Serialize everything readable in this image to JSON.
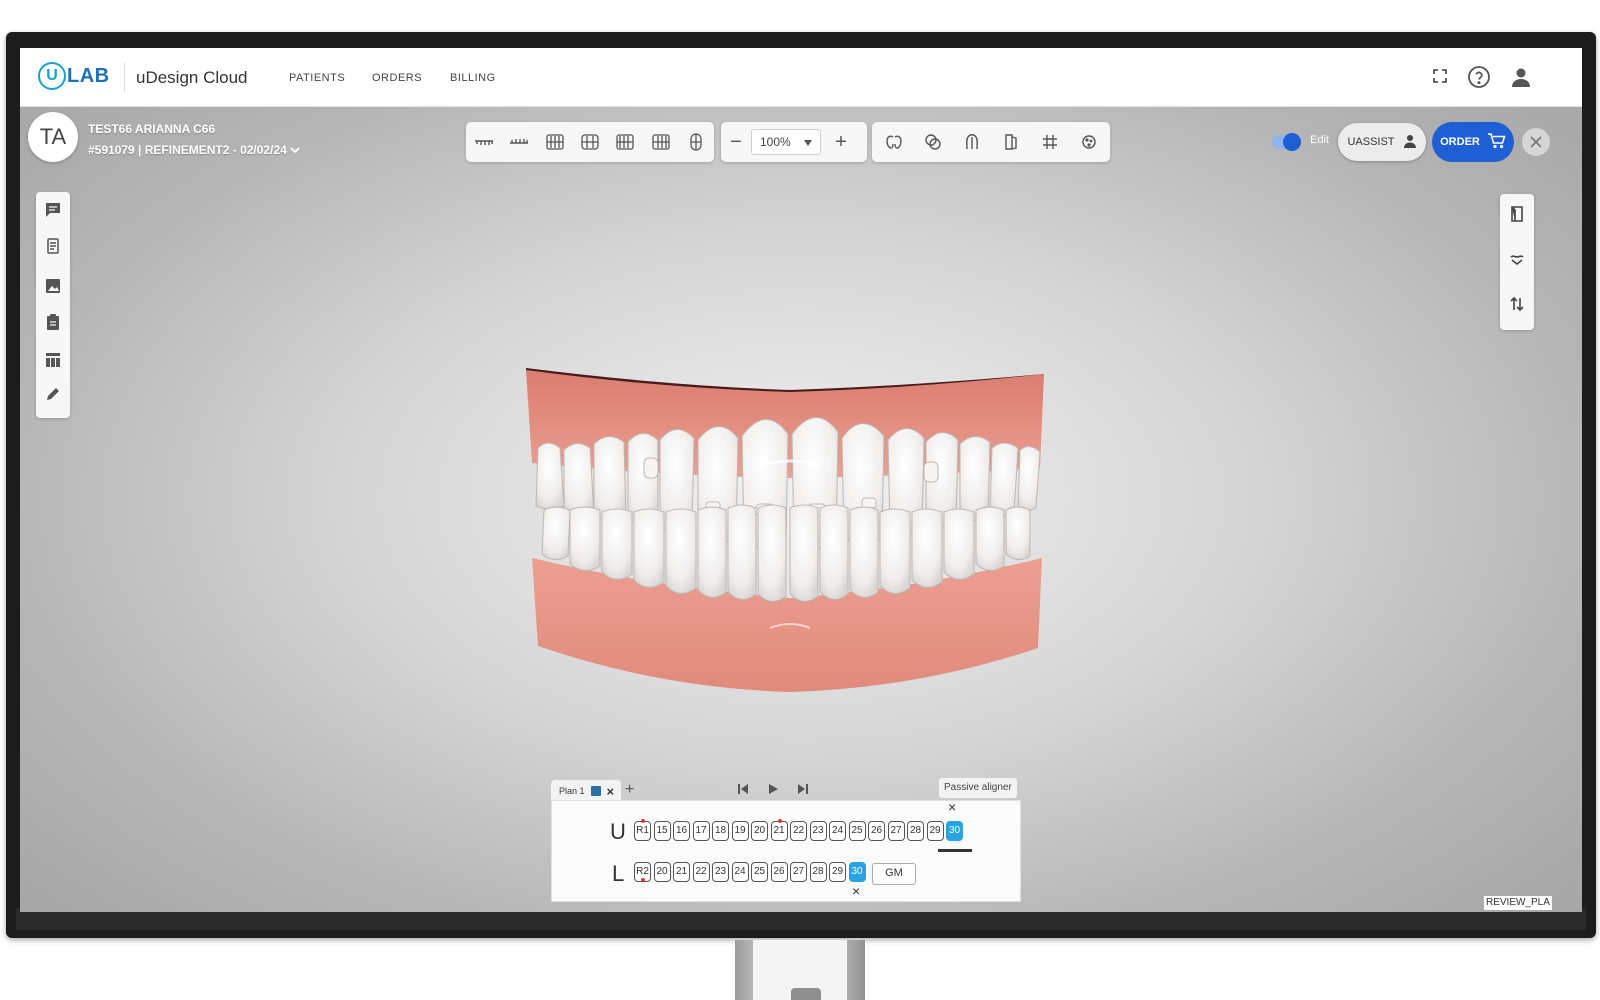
{
  "app": {
    "logo_letter": "U",
    "logo_word": "LAB",
    "name": "uDesign Cloud"
  },
  "nav": {
    "patients": "PATIENTS",
    "orders": "ORDERS",
    "billing": "BILLING"
  },
  "patient": {
    "initials": "TA",
    "name": "TEST66 ARIANNA C66",
    "case": "#591079 | REFINEMENT2 - 02/02/24"
  },
  "toolbar": {
    "zoom_value": "100%",
    "zoom_out": "−",
    "zoom_in": "+"
  },
  "header_right": {
    "edit_label": "Edit",
    "edit_on": true,
    "uassist_label": "UASSIST",
    "order_label": "ORDER"
  },
  "colors": {
    "accent_blue": "#1f5fd4",
    "active_step": "#29a3e3",
    "gum": "#e79a8c",
    "tooth": "#f5f3f1",
    "attachment_marker": "#e53935"
  },
  "staging": {
    "plan_tab": "Plan 1",
    "passive_aligner": "Passive aligner",
    "upper_label": "U",
    "lower_label": "L",
    "upper_steps": [
      "R1",
      "15",
      "16",
      "17",
      "18",
      "19",
      "20",
      "21",
      "22",
      "23",
      "24",
      "25",
      "26",
      "27",
      "28",
      "29",
      "30"
    ],
    "lower_steps": [
      "R2",
      "20",
      "21",
      "22",
      "23",
      "24",
      "25",
      "26",
      "27",
      "28",
      "29",
      "30"
    ],
    "upper_active": "30",
    "lower_active": "30",
    "gm_label": "GM",
    "x_marker": "×"
  },
  "footer": {
    "review_label": "REVIEW_PLA"
  }
}
